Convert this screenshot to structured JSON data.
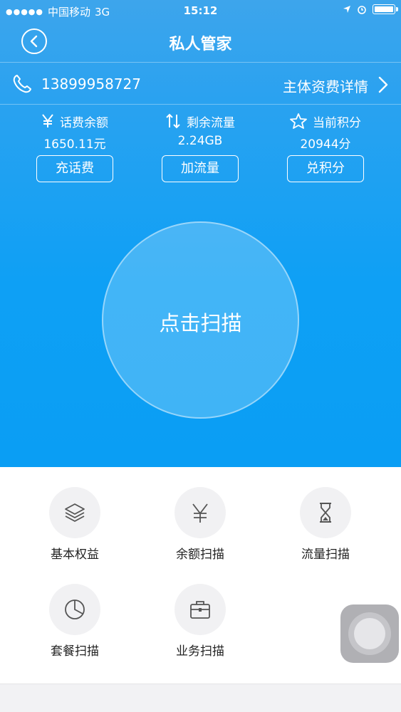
{
  "status_bar": {
    "signal": "●●●●●",
    "carrier": "中国移动",
    "network": "3G",
    "time": "15:12"
  },
  "nav": {
    "title": "私人管家"
  },
  "account": {
    "phone": "13899958727",
    "details_link": "主体资费详情"
  },
  "stats": [
    {
      "label": "话费余额",
      "value": "1650.11元",
      "button": "充话费",
      "icon": "yen-icon"
    },
    {
      "label": "剩余流量",
      "value": "2.24GB",
      "button": "加流量",
      "icon": "up-down-arrows-icon"
    },
    {
      "label": "当前积分",
      "value": "20944分",
      "button": "兑积分",
      "icon": "star-icon"
    }
  ],
  "scan": {
    "label": "点击扫描"
  },
  "grid": [
    {
      "label": "基本权益",
      "icon": "layers-icon"
    },
    {
      "label": "余额扫描",
      "icon": "yen-icon"
    },
    {
      "label": "流量扫描",
      "icon": "hourglass-icon"
    },
    {
      "label": "套餐扫描",
      "icon": "pie-chart-icon"
    },
    {
      "label": "业务扫描",
      "icon": "briefcase-icon"
    }
  ],
  "colors": {
    "header_blue": "#0ea0f5",
    "icon_gray": "#555555"
  }
}
